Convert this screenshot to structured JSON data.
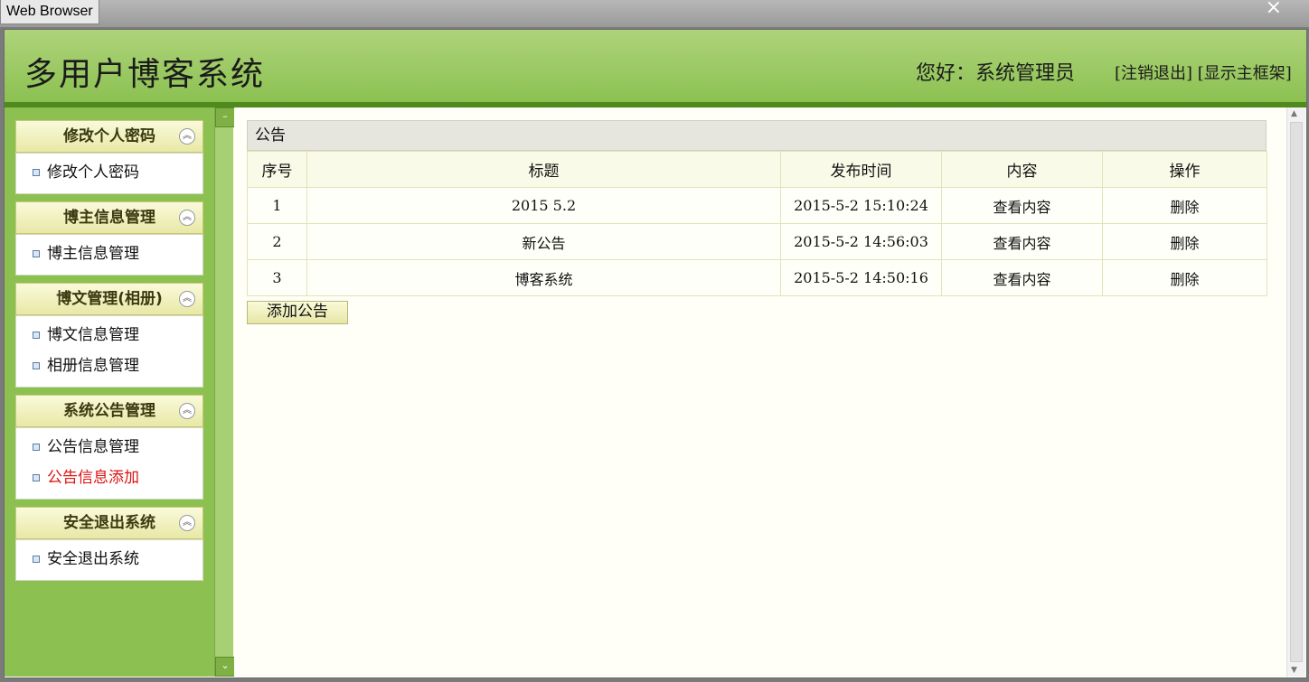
{
  "window": {
    "title": "Web Browser",
    "close_glyph": "×"
  },
  "header": {
    "logo": "多用户博客系统",
    "welcome": "您好：系统管理员",
    "logout": "[注销退出]",
    "show_frame": "[显示主框架]"
  },
  "sidebar": {
    "groups": [
      {
        "title": "修改个人密码",
        "items": [
          "修改个人密码"
        ]
      },
      {
        "title": "博主信息管理",
        "items": [
          "博主信息管理"
        ]
      },
      {
        "title": "博文管理(相册)",
        "items": [
          "博文信息管理",
          "相册信息管理"
        ]
      },
      {
        "title": "系统公告管理",
        "items": [
          "公告信息管理",
          "公告信息添加"
        ]
      },
      {
        "title": "安全退出系统",
        "items": [
          "安全退出系统"
        ]
      }
    ],
    "active_item": "公告信息添加"
  },
  "panel": {
    "title": "公告",
    "columns": [
      "序号",
      "标题",
      "发布时间",
      "内容",
      "操作"
    ],
    "rows": [
      {
        "no": "1",
        "title": "2015 5.2",
        "time": "2015-5-2 15:10:24",
        "content": "查看内容",
        "action": "删除"
      },
      {
        "no": "2",
        "title": "新公告",
        "time": "2015-5-2 14:56:03",
        "content": "查看内容",
        "action": "删除"
      },
      {
        "no": "3",
        "title": "博客系统",
        "time": "2015-5-2 14:50:16",
        "content": "查看内容",
        "action": "删除"
      }
    ],
    "add_button": "添加公告"
  },
  "icons": {
    "toggle": "chevron-up-circle-icon",
    "bullet": "square-bullet-icon"
  },
  "colors": {
    "header_green": "#8cc152",
    "active_red": "#e01010",
    "menu_head": "#f0f0bc"
  }
}
